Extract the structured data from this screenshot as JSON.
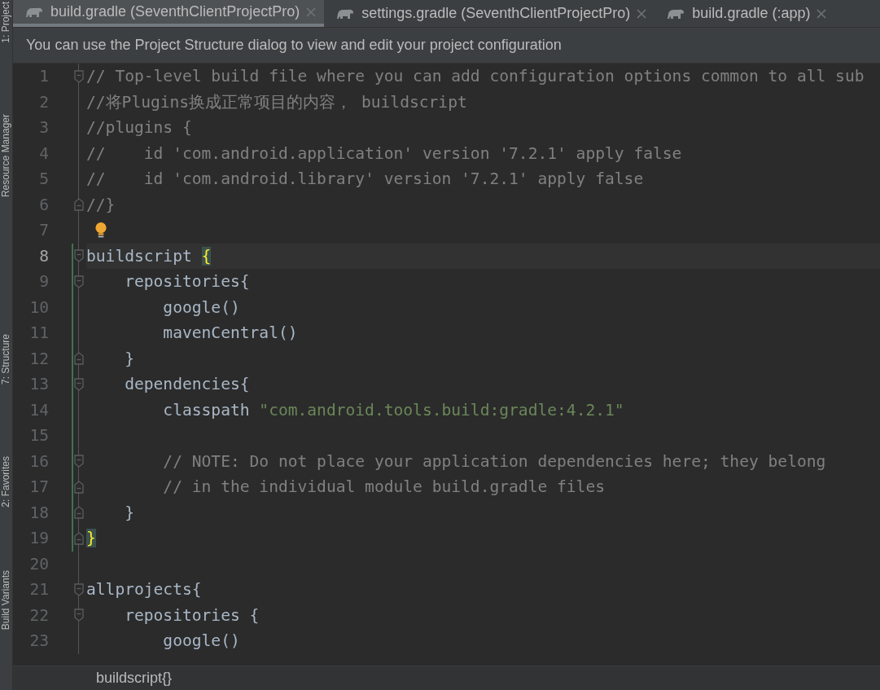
{
  "side_tools": [
    {
      "label": "1: Project"
    },
    {
      "label": "Resource Manager"
    },
    {
      "label": "7: Structure"
    },
    {
      "label": "2: Favorites"
    },
    {
      "label": "Build Variants"
    }
  ],
  "tabs": [
    {
      "label": "build.gradle (SeventhClientProjectPro)",
      "selected": true
    },
    {
      "label": "settings.gradle (SeventhClientProjectPro)",
      "selected": false
    },
    {
      "label": "build.gradle (:app)",
      "selected": false
    }
  ],
  "notification": "You can use the Project Structure dialog to view and edit your project configuration",
  "lines": [
    {
      "number": "1",
      "fold_start": true,
      "fold_end": false,
      "changed": false,
      "current": false,
      "segments": [
        {
          "kind": "comment",
          "text": "// Top-level build file where you can add configuration options common to all sub"
        }
      ]
    },
    {
      "number": "2",
      "fold_start": false,
      "fold_end": false,
      "changed": false,
      "current": false,
      "segments": [
        {
          "kind": "comment",
          "text": "//将Plugins换成正常项目的内容， buildscript"
        }
      ]
    },
    {
      "number": "3",
      "fold_start": false,
      "fold_end": false,
      "changed": false,
      "current": false,
      "segments": [
        {
          "kind": "comment",
          "text": "//plugins {"
        }
      ]
    },
    {
      "number": "4",
      "fold_start": false,
      "fold_end": false,
      "changed": false,
      "current": false,
      "segments": [
        {
          "kind": "comment",
          "text": "//    id 'com.android.application' version '7.2.1' apply false"
        }
      ]
    },
    {
      "number": "5",
      "fold_start": false,
      "fold_end": false,
      "changed": false,
      "current": false,
      "segments": [
        {
          "kind": "comment",
          "text": "//    id 'com.android.library' version '7.2.1' apply false"
        }
      ]
    },
    {
      "number": "6",
      "fold_start": false,
      "fold_end": true,
      "changed": false,
      "current": false,
      "segments": [
        {
          "kind": "comment",
          "text": "//}"
        }
      ]
    },
    {
      "number": "7",
      "fold_start": false,
      "fold_end": false,
      "changed": false,
      "current": false,
      "intention_bulb": true
    },
    {
      "number": "8",
      "fold_start": true,
      "fold_end": false,
      "changed": true,
      "current": true,
      "segments": [
        {
          "kind": "plain",
          "text": "buildscript "
        },
        {
          "kind": "brace_match",
          "text": "{"
        }
      ]
    },
    {
      "number": "9",
      "fold_start": true,
      "fold_end": false,
      "changed": true,
      "current": false,
      "segments": [
        {
          "kind": "plain",
          "text": "    repositories{"
        }
      ]
    },
    {
      "number": "10",
      "fold_start": false,
      "fold_end": false,
      "changed": true,
      "current": false,
      "segments": [
        {
          "kind": "plain",
          "text": "        google()"
        }
      ]
    },
    {
      "number": "11",
      "fold_start": false,
      "fold_end": false,
      "changed": true,
      "current": false,
      "segments": [
        {
          "kind": "plain",
          "text": "        mavenCentral()"
        }
      ]
    },
    {
      "number": "12",
      "fold_start": false,
      "fold_end": true,
      "changed": true,
      "current": false,
      "segments": [
        {
          "kind": "plain",
          "text": "    }"
        }
      ]
    },
    {
      "number": "13",
      "fold_start": true,
      "fold_end": false,
      "changed": true,
      "current": false,
      "segments": [
        {
          "kind": "plain",
          "text": "    dependencies{"
        }
      ]
    },
    {
      "number": "14",
      "fold_start": false,
      "fold_end": false,
      "changed": true,
      "current": false,
      "segments": [
        {
          "kind": "plain",
          "text": "        classpath "
        },
        {
          "kind": "string",
          "text": "\"com.android.tools.build:gradle:4.2.1\""
        }
      ]
    },
    {
      "number": "15",
      "fold_start": false,
      "fold_end": false,
      "changed": true,
      "current": false
    },
    {
      "number": "16",
      "fold_start": true,
      "fold_end": false,
      "changed": true,
      "current": false,
      "segments": [
        {
          "kind": "comment",
          "text": "        // NOTE: Do not place your application dependencies here; they belong"
        }
      ]
    },
    {
      "number": "17",
      "fold_start": false,
      "fold_end": true,
      "changed": true,
      "current": false,
      "segments": [
        {
          "kind": "comment",
          "text": "        // in the individual module build.gradle files"
        }
      ]
    },
    {
      "number": "18",
      "fold_start": false,
      "fold_end": true,
      "changed": true,
      "current": false,
      "segments": [
        {
          "kind": "plain",
          "text": "    }"
        }
      ]
    },
    {
      "number": "19",
      "fold_start": false,
      "fold_end": true,
      "changed": true,
      "current": false,
      "segments": [
        {
          "kind": "brace_match",
          "text": "}"
        }
      ]
    },
    {
      "number": "20",
      "fold_start": false,
      "fold_end": false,
      "changed": false,
      "current": false
    },
    {
      "number": "21",
      "fold_start": true,
      "fold_end": false,
      "changed": false,
      "current": false,
      "segments": [
        {
          "kind": "plain",
          "text": "allprojects{"
        }
      ]
    },
    {
      "number": "22",
      "fold_start": true,
      "fold_end": false,
      "changed": false,
      "current": false,
      "segments": [
        {
          "kind": "plain",
          "text": "    repositories {"
        }
      ]
    },
    {
      "number": "23",
      "fold_start": false,
      "fold_end": false,
      "changed": false,
      "current": false,
      "segments": [
        {
          "kind": "plain",
          "text": "        google()"
        }
      ]
    }
  ],
  "breadcrumb": "buildscript{}"
}
